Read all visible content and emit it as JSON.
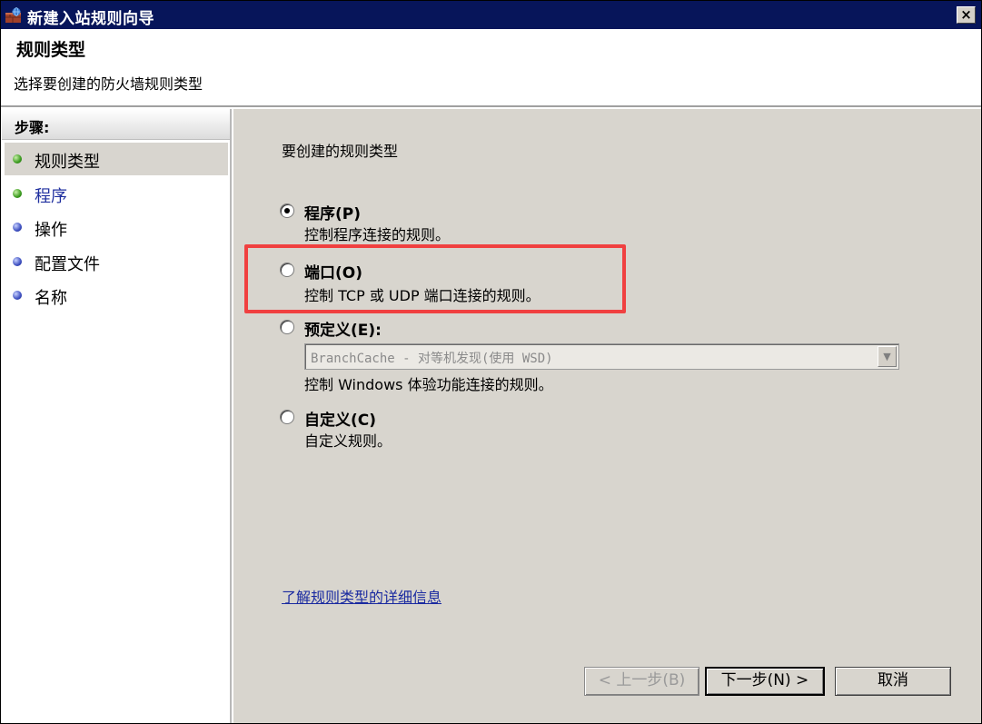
{
  "window": {
    "title": "新建入站规则向导",
    "close_glyph": "×"
  },
  "header": {
    "title": "规则类型",
    "description": "选择要创建的防火墙规则类型"
  },
  "sidebar": {
    "heading": "步骤:",
    "items": [
      {
        "label": "规则类型",
        "status": "current"
      },
      {
        "label": "程序",
        "status": "next"
      },
      {
        "label": "操作",
        "status": "pending"
      },
      {
        "label": "配置文件",
        "status": "pending"
      },
      {
        "label": "名称",
        "status": "pending"
      }
    ]
  },
  "main": {
    "section_title": "要创建的规则类型",
    "options": [
      {
        "label": "程序(P)",
        "description": "控制程序连接的规则。",
        "selected": true
      },
      {
        "label": "端口(O)",
        "description": "控制 TCP 或 UDP 端口连接的规则。",
        "selected": false
      },
      {
        "label": "预定义(E):",
        "description": "控制 Windows 体验功能连接的规则。",
        "selected": false
      },
      {
        "label": "自定义(C)",
        "description": "自定义规则。",
        "selected": false
      }
    ],
    "predefined_dropdown": {
      "value": "BranchCache - 对等机发现(使用 WSD)",
      "disabled": true
    },
    "learn_more_link": "了解规则类型的详细信息"
  },
  "buttons": {
    "back": "< 上一步(B)",
    "next": "下一步(N) >",
    "cancel": "取消"
  },
  "colors": {
    "titlebar": "#07155a",
    "content_bg": "#d8d5ce",
    "highlight": "#f04040",
    "link": "#1a2aa0"
  }
}
